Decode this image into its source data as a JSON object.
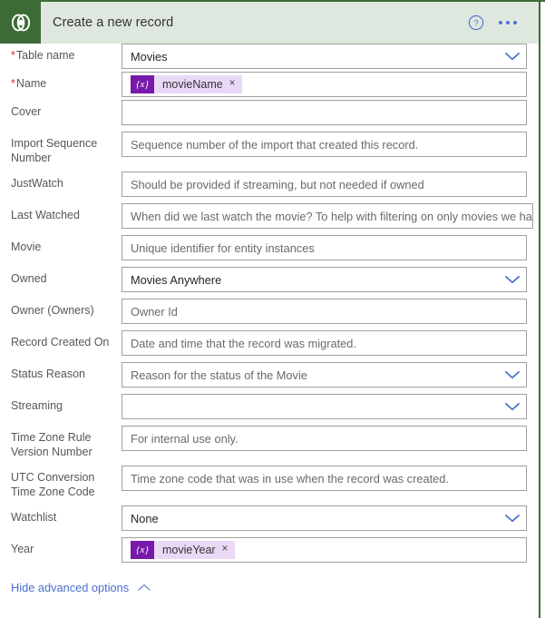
{
  "header": {
    "title": "Create a new record",
    "app_icon": "dataverse-icon",
    "help_icon": "help-circle-icon",
    "more_icon": "ellipsis-icon",
    "bg_color": "#dfe8df",
    "accent_color": "#3d6b37",
    "link_color": "#4c6fd0"
  },
  "colors": {
    "token_badge": "#7719aa",
    "token_pill": "#e9d9f7",
    "required_asterisk": "#d03438",
    "chevron": "#4c6fd0",
    "field_border": "#a0a0a0"
  },
  "fields": [
    {
      "label": "Table name",
      "required": true,
      "type": "dropdown",
      "value": "Movies",
      "is_value": true,
      "placeholder": ""
    },
    {
      "label": "Name",
      "required": true,
      "type": "token",
      "token": {
        "badge": "{x}",
        "label": "movieName",
        "remove": "×"
      }
    },
    {
      "label": "Cover",
      "required": false,
      "type": "text",
      "value": "",
      "is_value": false,
      "placeholder": ""
    },
    {
      "label": "Import Sequence Number",
      "required": false,
      "type": "text",
      "value": "Sequence number of the import that created this record.",
      "is_value": false
    },
    {
      "label": "JustWatch",
      "required": false,
      "type": "text",
      "value": "Should be provided if streaming, but not needed if owned",
      "is_value": false
    },
    {
      "label": "Last Watched",
      "required": false,
      "type": "text",
      "value": "When did we last watch the movie? To help with filtering on only movies we ha",
      "is_value": false
    },
    {
      "label": "Movie",
      "required": false,
      "type": "text",
      "value": "Unique identifier for entity instances",
      "is_value": false
    },
    {
      "label": "Owned",
      "required": false,
      "type": "dropdown",
      "value": "Movies Anywhere",
      "is_value": true
    },
    {
      "label": "Owner (Owners)",
      "required": false,
      "type": "text",
      "value": "Owner Id",
      "is_value": false
    },
    {
      "label": "Record Created On",
      "required": false,
      "type": "text",
      "value": "Date and time that the record was migrated.",
      "is_value": false
    },
    {
      "label": "Status Reason",
      "required": false,
      "type": "dropdown",
      "value": "Reason for the status of the Movie",
      "is_value": false
    },
    {
      "label": "Streaming",
      "required": false,
      "type": "dropdown",
      "value": "",
      "is_value": false
    },
    {
      "label": "Time Zone Rule Version Number",
      "required": false,
      "type": "text",
      "value": "For internal use only.",
      "is_value": false
    },
    {
      "label": "UTC Conversion Time Zone Code",
      "required": false,
      "type": "text",
      "value": "Time zone code that was in use when the record was created.",
      "is_value": false
    },
    {
      "label": "Watchlist",
      "required": false,
      "type": "dropdown",
      "value": "None",
      "is_value": true
    },
    {
      "label": "Year",
      "required": false,
      "type": "token",
      "token": {
        "badge": "{x}",
        "label": "movieYear",
        "remove": "×"
      }
    }
  ],
  "advanced": {
    "label": "Hide advanced options",
    "icon": "chevron-up-icon"
  }
}
